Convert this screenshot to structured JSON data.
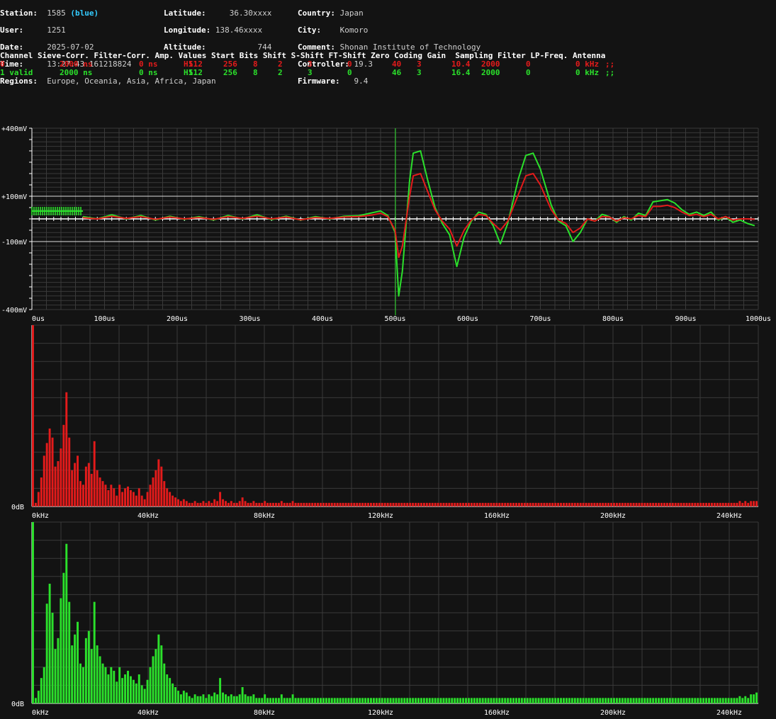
{
  "colors": {
    "ch0": "#e31b1b",
    "ch1": "#2be02b",
    "grid": "#3a3a3a",
    "axis": "#ffffff",
    "bg": "#131313"
  },
  "station": {
    "station_label": "Station:",
    "station_value": "1585",
    "station_color": "(blue)",
    "user_label": "User:",
    "user_value": "1251",
    "date_label": "Date:",
    "date_value": "2025-07-02",
    "time_label": "Time:",
    "time_value": "13:27:43.161218824",
    "regions_label": "Regions:",
    "regions_value": "Europe, Oceania, Asia, Africa, Japan",
    "lat_label": "Latitude:",
    "lat_value": "36.30xxxx",
    "lon_label": "Longitude:",
    "lon_value": "138.46xxxx",
    "alt_label": "Altitude:",
    "alt_value": "744",
    "country_label": "Country:",
    "country_value": "Japan",
    "city_label": "City:",
    "city_value": "Komoro",
    "comment_label": "Comment:",
    "comment_value": "Shonan Institute of Technology",
    "controller_label": "Controller:",
    "controller_value": "19.3",
    "firmware_label": "Firmware:",
    "firmware_value": "9.4"
  },
  "channel_table": {
    "header": "Channel Sieve-Corr. Filter-Corr. Amp. Values Start Bits Shift S-Shift FT-Shift Zero Coding Gain  Sampling Filter LP-Freq. Antenna",
    "rows": [
      {
        "channel": "0",
        "sieve": "2000 ns",
        "filter": "0 ns",
        "amp": "H1",
        "values": "512",
        "start": "256",
        "bits": "8",
        "shift": "2",
        "sshift": "3",
        "ftshift": "0",
        "zero": "40",
        "coding": "3",
        "gain": "10.4",
        "sampling": "2000",
        "filt": "0",
        "lpfreq": "0 kHz",
        "antenna": ";;"
      },
      {
        "channel": "1 valid",
        "sieve": "2000 ns",
        "filter": "0 ns",
        "amp": "H1",
        "values": "512",
        "start": "256",
        "bits": "8",
        "shift": "2",
        "sshift": "3",
        "ftshift": "0",
        "zero": "46",
        "coding": "3",
        "gain": "16.4",
        "sampling": "2000",
        "filt": "0",
        "lpfreq": "0 kHz",
        "antenna": ";;"
      }
    ]
  },
  "chart_data": [
    {
      "type": "line",
      "xlim": [
        0,
        1000
      ],
      "ylim": [
        -400,
        400
      ],
      "x_ticks": [
        "0us",
        "100us",
        "200us",
        "300us",
        "400us",
        "500us",
        "600us",
        "700us",
        "800us",
        "900us",
        "1000us"
      ],
      "y_ticks": [
        {
          "value": 400,
          "label": "+400mV"
        },
        {
          "value": 100,
          "label": "+100mV"
        },
        {
          "value": -100,
          "label": "-100mV"
        },
        {
          "value": -400,
          "label": "-400mV"
        }
      ],
      "trigger_x": 500,
      "grid": true,
      "series": [
        {
          "channel": "0",
          "points": [
            [
              70,
              5
            ],
            [
              90,
              0
            ],
            [
              110,
              12
            ],
            [
              130,
              2
            ],
            [
              150,
              10
            ],
            [
              170,
              -2
            ],
            [
              190,
              8
            ],
            [
              210,
              0
            ],
            [
              230,
              6
            ],
            [
              250,
              -2
            ],
            [
              270,
              10
            ],
            [
              290,
              2
            ],
            [
              310,
              12
            ],
            [
              330,
              0
            ],
            [
              350,
              8
            ],
            [
              370,
              -4
            ],
            [
              390,
              6
            ],
            [
              410,
              2
            ],
            [
              430,
              8
            ],
            [
              450,
              10
            ],
            [
              470,
              18
            ],
            [
              480,
              25
            ],
            [
              490,
              10
            ],
            [
              500,
              -50
            ],
            [
              505,
              -170
            ],
            [
              510,
              -120
            ],
            [
              520,
              100
            ],
            [
              525,
              190
            ],
            [
              535,
              200
            ],
            [
              545,
              120
            ],
            [
              555,
              40
            ],
            [
              565,
              -10
            ],
            [
              575,
              -45
            ],
            [
              585,
              -120
            ],
            [
              595,
              -50
            ],
            [
              605,
              -5
            ],
            [
              615,
              20
            ],
            [
              625,
              15
            ],
            [
              635,
              -20
            ],
            [
              645,
              -50
            ],
            [
              655,
              -10
            ],
            [
              670,
              110
            ],
            [
              680,
              190
            ],
            [
              690,
              200
            ],
            [
              700,
              150
            ],
            [
              715,
              40
            ],
            [
              725,
              -5
            ],
            [
              735,
              -20
            ],
            [
              745,
              -60
            ],
            [
              755,
              -40
            ],
            [
              765,
              0
            ],
            [
              775,
              -10
            ],
            [
              785,
              10
            ],
            [
              795,
              8
            ],
            [
              805,
              -10
            ],
            [
              815,
              5
            ],
            [
              825,
              0
            ],
            [
              835,
              15
            ],
            [
              845,
              10
            ],
            [
              855,
              55
            ],
            [
              865,
              55
            ],
            [
              875,
              60
            ],
            [
              885,
              50
            ],
            [
              895,
              30
            ],
            [
              905,
              15
            ],
            [
              915,
              20
            ],
            [
              925,
              10
            ],
            [
              935,
              20
            ],
            [
              945,
              0
            ],
            [
              955,
              10
            ],
            [
              965,
              -5
            ],
            [
              975,
              0
            ],
            [
              985,
              0
            ],
            [
              995,
              -2
            ]
          ]
        },
        {
          "channel": "1",
          "points": [
            [
              70,
              10
            ],
            [
              90,
              0
            ],
            [
              110,
              18
            ],
            [
              130,
              0
            ],
            [
              150,
              15
            ],
            [
              170,
              -5
            ],
            [
              190,
              12
            ],
            [
              210,
              -2
            ],
            [
              230,
              10
            ],
            [
              250,
              -5
            ],
            [
              270,
              15
            ],
            [
              290,
              0
            ],
            [
              310,
              18
            ],
            [
              330,
              -3
            ],
            [
              350,
              12
            ],
            [
              370,
              -5
            ],
            [
              390,
              10
            ],
            [
              410,
              0
            ],
            [
              430,
              12
            ],
            [
              450,
              14
            ],
            [
              470,
              28
            ],
            [
              480,
              35
            ],
            [
              490,
              15
            ],
            [
              500,
              -60
            ],
            [
              505,
              -340
            ],
            [
              510,
              -230
            ],
            [
              520,
              170
            ],
            [
              525,
              290
            ],
            [
              535,
              300
            ],
            [
              545,
              170
            ],
            [
              555,
              50
            ],
            [
              565,
              -20
            ],
            [
              575,
              -70
            ],
            [
              585,
              -210
            ],
            [
              595,
              -80
            ],
            [
              605,
              -10
            ],
            [
              615,
              30
            ],
            [
              625,
              20
            ],
            [
              635,
              -30
            ],
            [
              645,
              -110
            ],
            [
              655,
              -20
            ],
            [
              670,
              180
            ],
            [
              680,
              280
            ],
            [
              690,
              290
            ],
            [
              700,
              220
            ],
            [
              715,
              60
            ],
            [
              725,
              -10
            ],
            [
              735,
              -30
            ],
            [
              745,
              -100
            ],
            [
              755,
              -60
            ],
            [
              765,
              0
            ],
            [
              775,
              -10
            ],
            [
              785,
              20
            ],
            [
              795,
              10
            ],
            [
              805,
              -15
            ],
            [
              815,
              10
            ],
            [
              825,
              -5
            ],
            [
              835,
              25
            ],
            [
              845,
              15
            ],
            [
              855,
              75
            ],
            [
              865,
              80
            ],
            [
              875,
              85
            ],
            [
              885,
              70
            ],
            [
              895,
              40
            ],
            [
              905,
              20
            ],
            [
              915,
              30
            ],
            [
              925,
              15
            ],
            [
              935,
              30
            ],
            [
              945,
              -5
            ],
            [
              955,
              10
            ],
            [
              965,
              -15
            ],
            [
              975,
              -5
            ],
            [
              985,
              -20
            ],
            [
              995,
              -30
            ]
          ]
        }
      ]
    },
    {
      "type": "bar",
      "channel": "0",
      "xlim": [
        0,
        250
      ],
      "ylim": [
        0,
        100
      ],
      "x_ticks": [
        "0kHz",
        "40kHz",
        "80kHz",
        "120kHz",
        "160kHz",
        "200kHz",
        "240kHz"
      ],
      "y_tick": "0dB",
      "grid": true,
      "values": [
        100,
        2,
        8,
        16,
        28,
        35,
        43,
        38,
        22,
        25,
        32,
        45,
        63,
        38,
        20,
        24,
        28,
        14,
        12,
        22,
        24,
        18,
        36,
        20,
        16,
        14,
        12,
        9,
        12,
        10,
        6,
        12,
        8,
        10,
        11,
        9,
        8,
        6,
        10,
        6,
        4,
        8,
        12,
        16,
        20,
        26,
        22,
        14,
        10,
        8,
        6,
        5,
        4,
        3,
        4,
        3,
        2,
        2,
        3,
        2,
        2,
        3,
        2,
        3,
        2,
        4,
        3,
        8,
        4,
        3,
        2,
        3,
        2,
        2,
        3,
        5,
        3,
        2,
        2,
        3,
        2,
        2,
        2,
        3,
        2,
        2,
        2,
        2,
        2,
        3,
        2,
        2,
        2,
        3,
        2,
        2,
        2,
        2,
        2,
        2,
        2,
        2,
        2,
        2,
        2,
        2,
        2,
        2,
        2,
        2,
        2,
        2,
        2,
        2,
        2,
        2,
        2,
        2,
        2,
        2,
        2,
        2,
        2,
        2,
        2,
        2,
        2,
        2,
        2,
        2,
        2,
        2,
        2,
        2,
        2,
        2,
        2,
        2,
        2,
        2,
        2,
        2,
        2,
        2,
        2,
        2,
        2,
        2,
        2,
        2,
        2,
        2,
        2,
        2,
        2,
        2,
        2,
        2,
        2,
        2,
        2,
        2,
        2,
        2,
        2,
        2,
        2,
        2,
        2,
        2,
        2,
        2,
        2,
        2,
        2,
        2,
        2,
        2,
        2,
        2,
        2,
        2,
        2,
        2,
        2,
        2,
        2,
        2,
        2,
        2,
        2,
        2,
        2,
        2,
        2,
        2,
        2,
        2,
        2,
        2,
        2,
        2,
        2,
        2,
        2,
        2,
        2,
        2,
        2,
        2,
        2,
        2,
        2,
        2,
        2,
        2,
        2,
        2,
        2,
        2,
        2,
        2,
        2,
        2,
        2,
        2,
        2,
        2,
        2,
        2,
        2,
        2,
        2,
        2,
        2,
        2,
        2,
        2,
        2,
        2,
        2,
        2,
        2,
        2,
        2,
        2,
        2,
        2,
        2,
        2,
        2,
        2,
        2,
        3,
        2,
        3,
        2,
        3,
        3,
        3
      ]
    },
    {
      "type": "bar",
      "channel": "1",
      "xlim": [
        0,
        250
      ],
      "ylim": [
        0,
        100
      ],
      "x_ticks": [
        "0kHz",
        "40kHz",
        "80kHz",
        "120kHz",
        "160kHz",
        "200kHz",
        "240kHz"
      ],
      "y_tick": "0dB",
      "grid": true,
      "values": [
        100,
        3,
        7,
        14,
        20,
        55,
        66,
        50,
        30,
        36,
        58,
        72,
        88,
        56,
        32,
        38,
        45,
        22,
        20,
        36,
        40,
        30,
        56,
        32,
        26,
        22,
        20,
        16,
        20,
        18,
        12,
        20,
        14,
        16,
        18,
        15,
        13,
        11,
        16,
        10,
        8,
        13,
        20,
        26,
        30,
        38,
        32,
        22,
        16,
        14,
        11,
        9,
        7,
        5,
        7,
        6,
        4,
        3,
        5,
        4,
        4,
        5,
        3,
        5,
        4,
        6,
        5,
        14,
        6,
        5,
        4,
        5,
        4,
        4,
        5,
        9,
        5,
        4,
        4,
        5,
        3,
        3,
        3,
        5,
        3,
        3,
        3,
        3,
        3,
        5,
        3,
        3,
        3,
        5,
        3,
        3,
        3,
        3,
        3,
        3,
        3,
        3,
        3,
        3,
        3,
        3,
        3,
        3,
        3,
        3,
        3,
        3,
        3,
        3,
        3,
        3,
        3,
        3,
        3,
        3,
        3,
        3,
        3,
        3,
        3,
        3,
        3,
        3,
        3,
        3,
        3,
        3,
        3,
        3,
        3,
        3,
        3,
        3,
        3,
        3,
        3,
        3,
        3,
        3,
        3,
        3,
        3,
        3,
        3,
        3,
        3,
        3,
        3,
        3,
        3,
        3,
        3,
        3,
        3,
        3,
        3,
        3,
        3,
        3,
        3,
        3,
        3,
        3,
        3,
        3,
        3,
        3,
        3,
        3,
        3,
        3,
        3,
        3,
        3,
        3,
        3,
        3,
        3,
        3,
        3,
        3,
        3,
        3,
        3,
        3,
        3,
        3,
        3,
        3,
        3,
        3,
        3,
        3,
        3,
        3,
        3,
        3,
        3,
        3,
        3,
        3,
        3,
        3,
        3,
        3,
        3,
        3,
        3,
        3,
        3,
        3,
        3,
        3,
        3,
        3,
        3,
        3,
        3,
        3,
        3,
        3,
        3,
        3,
        3,
        3,
        3,
        3,
        3,
        3,
        3,
        3,
        3,
        3,
        3,
        3,
        3,
        3,
        3,
        3,
        3,
        3,
        3,
        3,
        3,
        3,
        3,
        3,
        3,
        4,
        3,
        4,
        3,
        5,
        5,
        6
      ]
    }
  ]
}
